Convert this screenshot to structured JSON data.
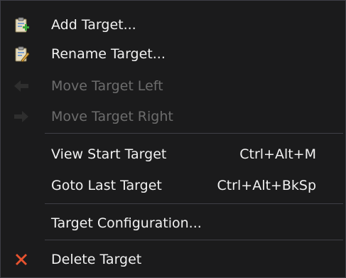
{
  "menu": {
    "items": [
      {
        "label": "Add Target...",
        "icon": "clipboard-add-icon"
      },
      {
        "label": "Rename Target...",
        "icon": "clipboard-edit-icon"
      },
      {
        "label": "Move Target Left",
        "icon": "arrow-left-icon",
        "disabled": true
      },
      {
        "label": "Move Target Right",
        "icon": "arrow-right-icon",
        "disabled": true
      },
      {
        "label": "View Start Target",
        "shortcut": "Ctrl+Alt+M"
      },
      {
        "label": "Goto Last Target",
        "shortcut": "Ctrl+Alt+BkSp"
      },
      {
        "label": "Target Configuration..."
      },
      {
        "label": "Delete Target",
        "icon": "delete-x-icon"
      }
    ]
  },
  "colors": {
    "background": "#1b1b1c",
    "text": "#f1f1f1",
    "disabled_text": "#6d6d6d",
    "separator": "#3f3f46",
    "delete_icon": "#e8532f",
    "clipboard_green": "#39a53a"
  }
}
